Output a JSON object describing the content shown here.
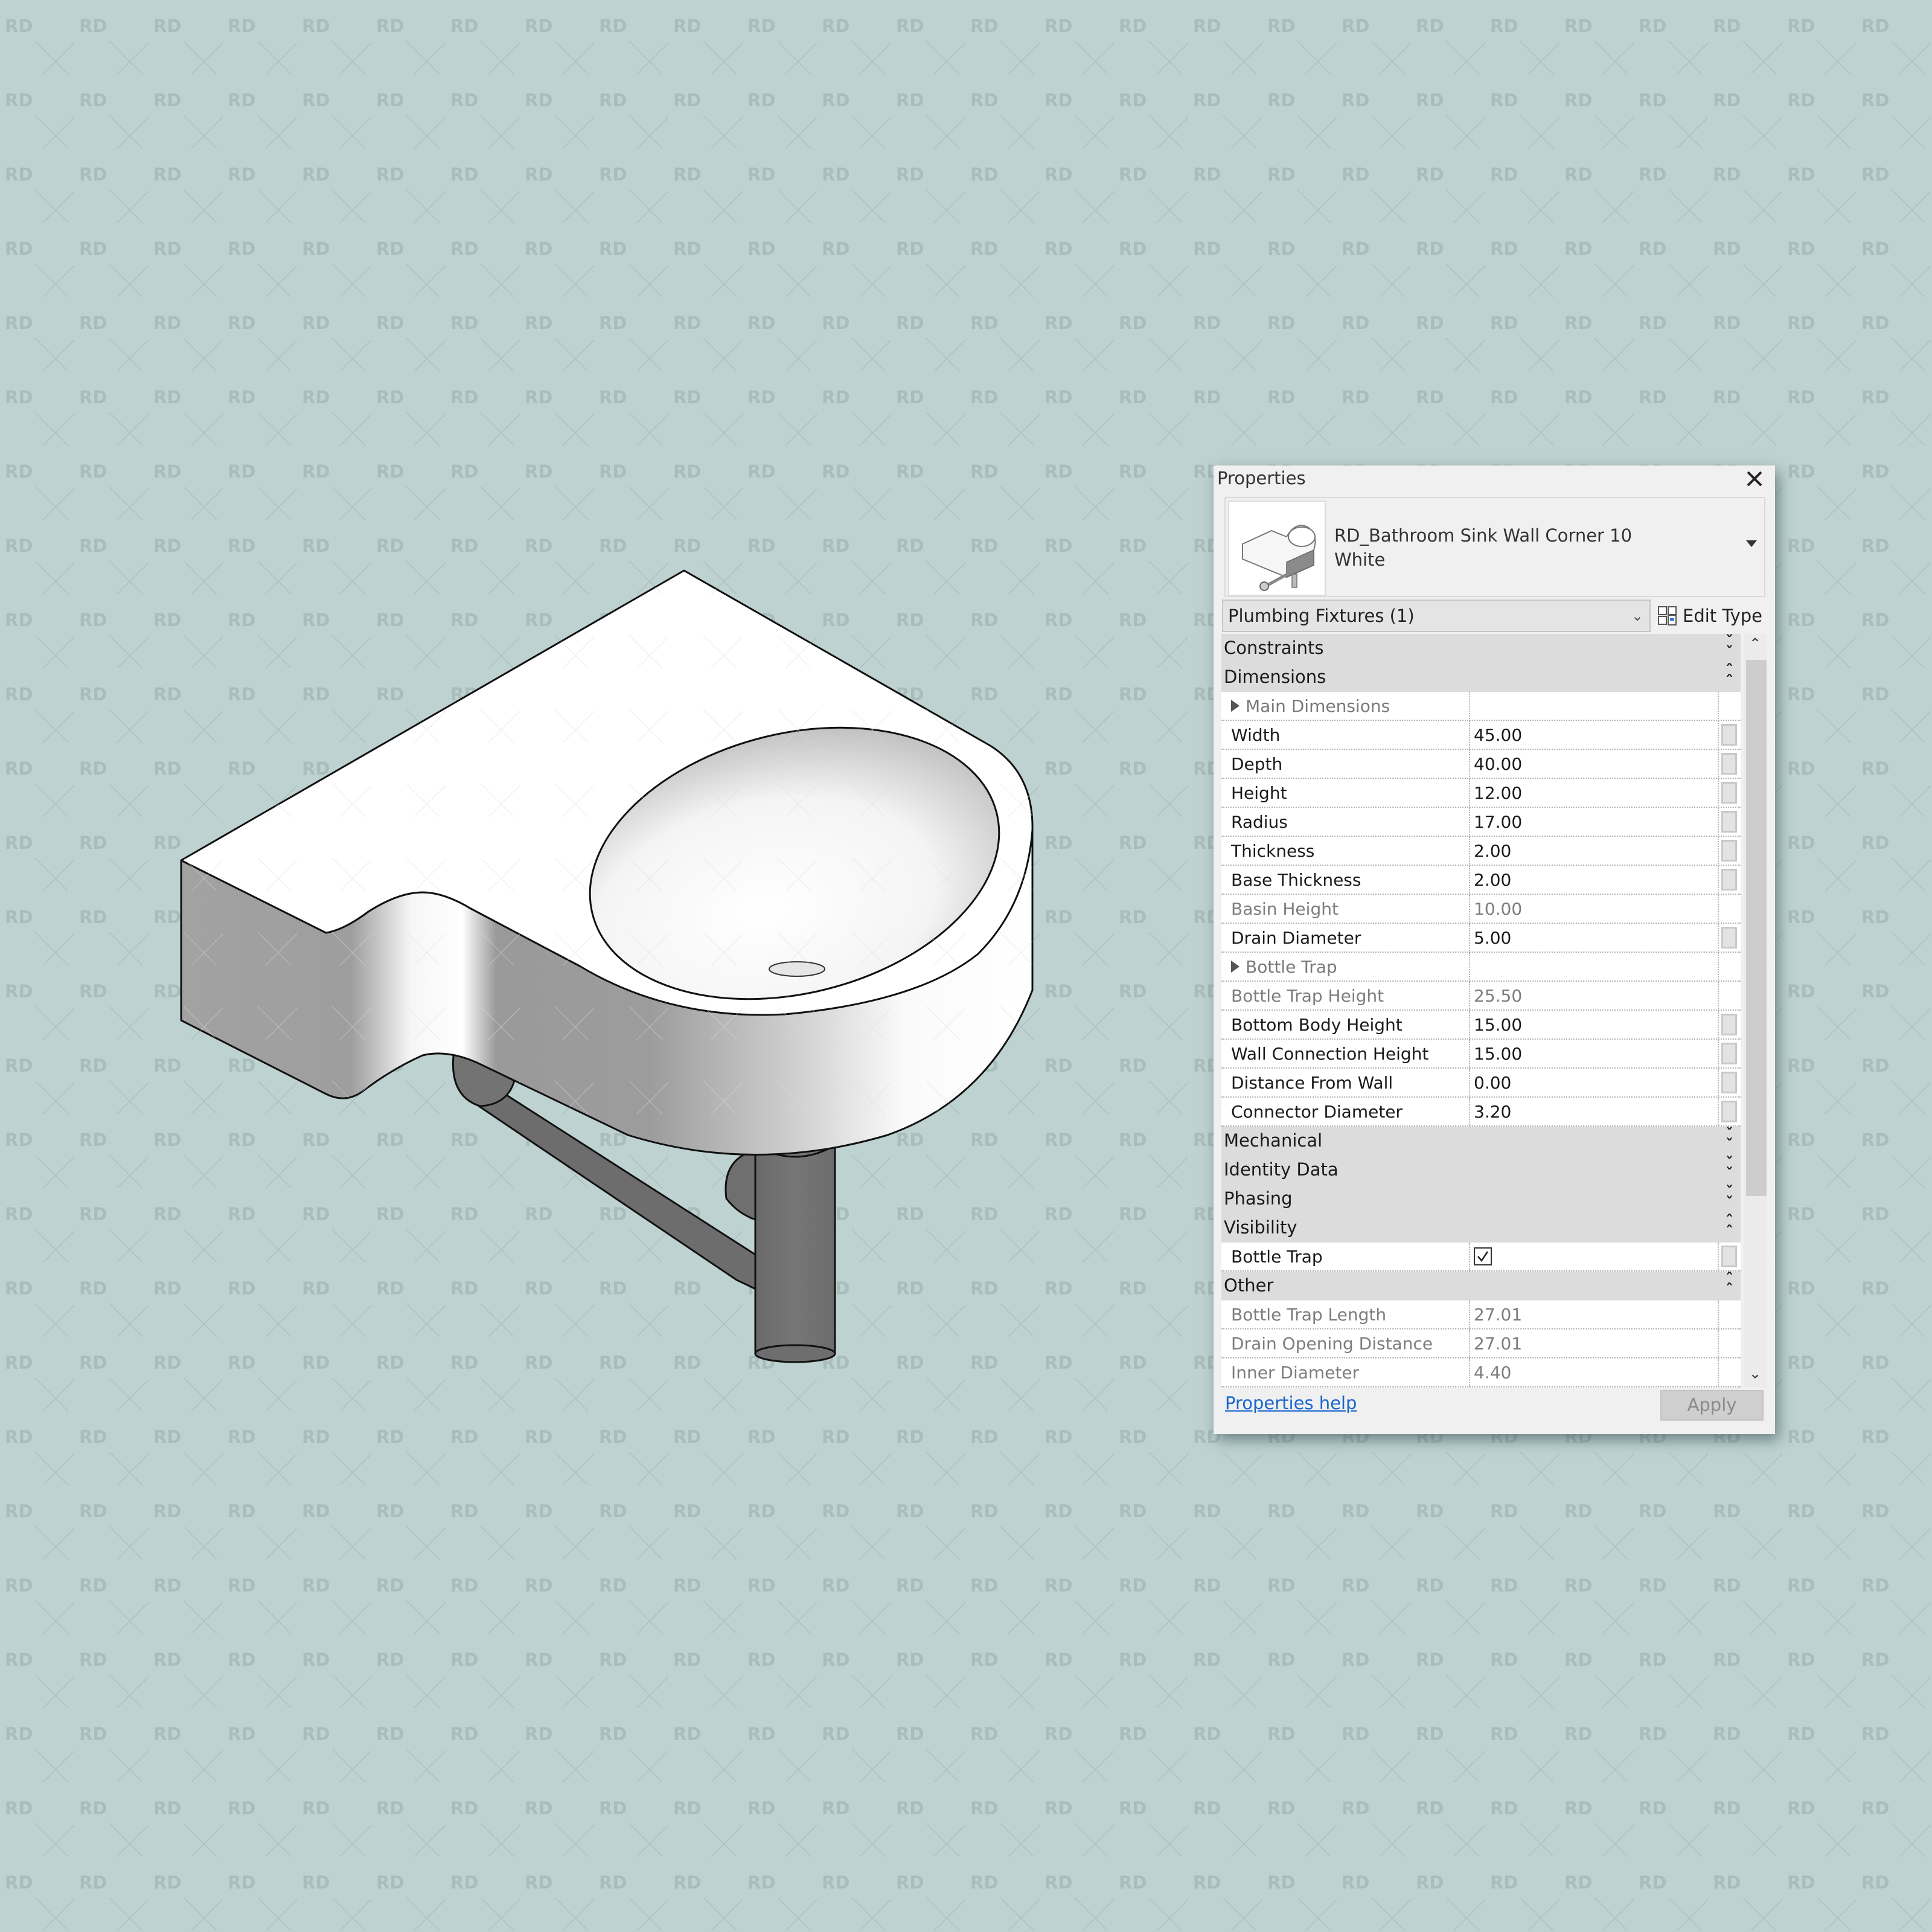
{
  "watermark": {
    "text": "RD",
    "color": "#a9bdbc"
  },
  "colors": {
    "background": "#bed2d1",
    "sink_white": "#ffffff",
    "sink_shadow": "#9a9a9a",
    "pipe": "#6f6f6f",
    "link": "#1a66cc"
  },
  "viewport": {
    "model_name": "bathroom-sink-3d-view"
  },
  "properties": {
    "title": "Properties",
    "close_icon": "close-icon",
    "type_selector": {
      "name_line1": "RD_Bathroom Sink Wall Corner 10",
      "name_line2": "White"
    },
    "category_filter": "Plumbing Fixtures (1)",
    "edit_type_label": "Edit Type",
    "rows": [
      {
        "kind": "section",
        "label": "Constraints",
        "state": "collapsed"
      },
      {
        "kind": "section",
        "label": "Dimensions",
        "state": "expanded"
      },
      {
        "kind": "group",
        "label": "Main Dimensions"
      },
      {
        "kind": "param",
        "name": "Width",
        "value": "45.00",
        "readonly": false,
        "assoc": true
      },
      {
        "kind": "param",
        "name": "Depth",
        "value": "40.00",
        "readonly": false,
        "assoc": true
      },
      {
        "kind": "param",
        "name": "Height",
        "value": "12.00",
        "readonly": false,
        "assoc": true
      },
      {
        "kind": "param",
        "name": "Radius",
        "value": "17.00",
        "readonly": false,
        "assoc": true
      },
      {
        "kind": "param",
        "name": "Thickness",
        "value": "2.00",
        "readonly": false,
        "assoc": true
      },
      {
        "kind": "param",
        "name": "Base Thickness",
        "value": "2.00",
        "readonly": false,
        "assoc": true
      },
      {
        "kind": "param",
        "name": "Basin Height",
        "value": "10.00",
        "readonly": true,
        "assoc": false
      },
      {
        "kind": "param",
        "name": "Drain Diameter",
        "value": "5.00",
        "readonly": false,
        "assoc": true
      },
      {
        "kind": "group",
        "label": "Bottle Trap"
      },
      {
        "kind": "param",
        "name": "Bottle Trap Height",
        "value": "25.50",
        "readonly": true,
        "assoc": false
      },
      {
        "kind": "param",
        "name": "Bottom Body Height",
        "value": "15.00",
        "readonly": false,
        "assoc": true
      },
      {
        "kind": "param",
        "name": "Wall Connection Height",
        "value": "15.00",
        "readonly": false,
        "assoc": true
      },
      {
        "kind": "param",
        "name": "Distance From Wall",
        "value": "0.00",
        "readonly": false,
        "assoc": true
      },
      {
        "kind": "param",
        "name": "Connector Diameter",
        "value": "3.20",
        "readonly": false,
        "assoc": true
      },
      {
        "kind": "section",
        "label": "Mechanical",
        "state": "collapsed"
      },
      {
        "kind": "section",
        "label": "Identity Data",
        "state": "collapsed"
      },
      {
        "kind": "section",
        "label": "Phasing",
        "state": "collapsed"
      },
      {
        "kind": "section",
        "label": "Visibility",
        "state": "expanded"
      },
      {
        "kind": "check",
        "name": "Bottle Trap",
        "checked": true,
        "assoc": true
      },
      {
        "kind": "section",
        "label": "Other",
        "state": "expanded"
      },
      {
        "kind": "param",
        "name": "Bottle Trap Length",
        "value": "27.01",
        "readonly": true,
        "assoc": false
      },
      {
        "kind": "param",
        "name": "Drain Opening Distance",
        "value": "27.01",
        "readonly": true,
        "assoc": false
      },
      {
        "kind": "param",
        "name": "Inner Diameter",
        "value": "4.40",
        "readonly": true,
        "assoc": false
      }
    ],
    "help_link": "Properties help",
    "apply_label": "Apply",
    "apply_enabled": false
  }
}
